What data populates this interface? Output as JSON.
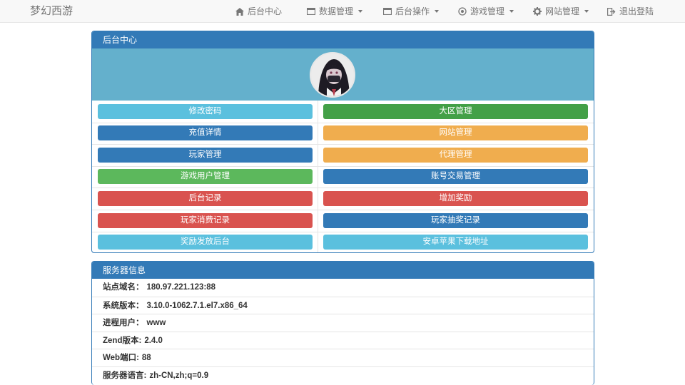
{
  "brand": "梦幻西游",
  "nav": {
    "home": "后台中心",
    "data": "数据管理",
    "ops": "后台操作",
    "game": "游戏管理",
    "site": "网站管理",
    "logout": "退出登陆"
  },
  "center_panel": {
    "title": "后台中心",
    "buttons_left": [
      {
        "label": "修改密码",
        "color": "#5bc0de"
      },
      {
        "label": "充值详情",
        "color": "#337ab7"
      },
      {
        "label": "玩家管理",
        "color": "#337ab7"
      },
      {
        "label": "游戏用户管理",
        "color": "#5cb85c"
      },
      {
        "label": "后台记录",
        "color": "#d9534f"
      },
      {
        "label": "玩家消费记录",
        "color": "#d9534f"
      },
      {
        "label": "奖励发放后台",
        "color": "#5bc0de"
      }
    ],
    "buttons_right": [
      {
        "label": "大区管理",
        "color": "#43a047"
      },
      {
        "label": "网站管理",
        "color": "#f0ad4e"
      },
      {
        "label": "代理管理",
        "color": "#f0ad4e"
      },
      {
        "label": "账号交易管理",
        "color": "#337ab7"
      },
      {
        "label": "增加奖励",
        "color": "#d9534f"
      },
      {
        "label": "玩家抽奖记录",
        "color": "#337ab7"
      },
      {
        "label": "安卓苹果下载地址",
        "color": "#5bc0de"
      }
    ]
  },
  "server_panel": {
    "title": "服务器信息",
    "rows": [
      {
        "label": "站点域名：",
        "value": "180.97.221.123:88"
      },
      {
        "label": "系统版本：",
        "value": "3.10.0-1062.7.1.el7.x86_64"
      },
      {
        "label": "进程用户：",
        "value": "www"
      },
      {
        "label": "Zend版本:",
        "value": "2.4.0"
      },
      {
        "label": "Web端口:",
        "value": "88"
      },
      {
        "label": "服务器语言:",
        "value": "zh-CN,zh;q=0.9"
      }
    ]
  }
}
